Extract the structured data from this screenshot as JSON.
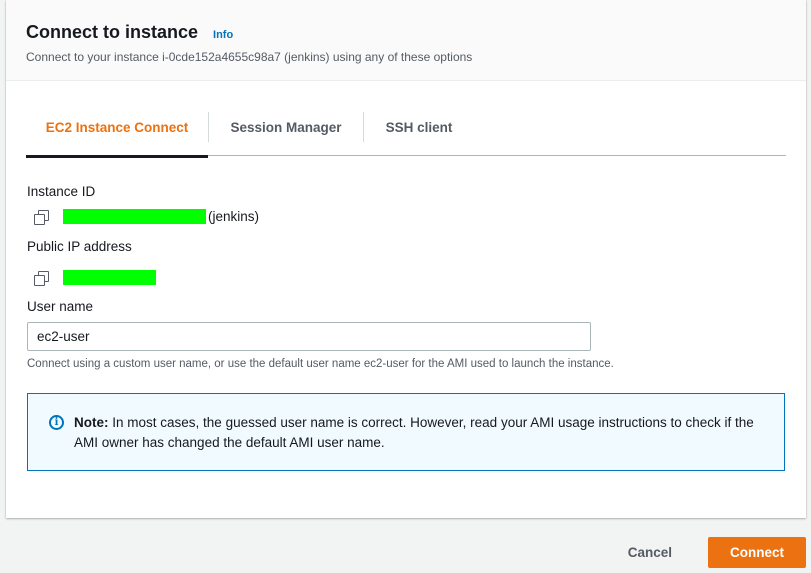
{
  "dialog": {
    "title": "Connect to instance",
    "info_link": "Info",
    "subtitle": "Connect to your instance i-0cde152a4655c98a7 (jenkins) using any of these options"
  },
  "tabs": [
    {
      "label": "EC2 Instance Connect",
      "active": true
    },
    {
      "label": "Session Manager",
      "active": false
    },
    {
      "label": "SSH client",
      "active": false
    }
  ],
  "instance": {
    "label": "Instance ID",
    "name_suffix": "(jenkins)",
    "redaction_color": "#00ff00"
  },
  "public_ip": {
    "label": "Public IP address"
  },
  "user_name": {
    "label": "User name",
    "value": "ec2-user",
    "hint": "Connect using a custom user name, or use the default user name ec2-user for the AMI used to launch the instance."
  },
  "alert": {
    "icon": "info-icon",
    "prefix": "Note:",
    "message": "In most cases, the guessed user name is correct. However, read your AMI usage instructions to check if the AMI owner has changed the default AMI user name."
  },
  "footer": {
    "cancel_label": "Cancel",
    "connect_label": "Connect"
  },
  "colors": {
    "accent": "#ec7211",
    "link": "#0073bb"
  }
}
